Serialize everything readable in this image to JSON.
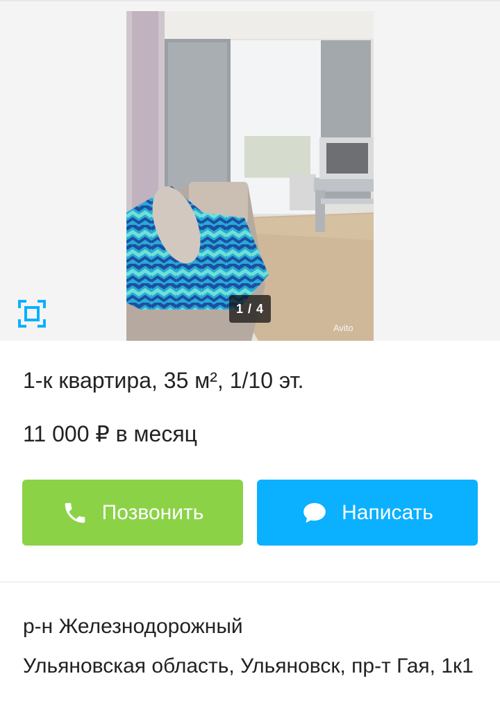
{
  "gallery": {
    "counter": "1 / 4",
    "watermark": "Avito"
  },
  "listing": {
    "title": "1-к квартира, 35 м², 1/10 эт.",
    "price": "11 000 ₽ в месяц"
  },
  "actions": {
    "call_label": "Позвонить",
    "write_label": "Написать"
  },
  "location": {
    "district": "р-н Железнодорожный",
    "address": "Ульяновская область, Ульяновск, пр-т Гая, 1к1"
  },
  "colors": {
    "call_button": "#8bd247",
    "write_button": "#0bb0ff",
    "fullscreen_icon": "#0bb0ff"
  }
}
